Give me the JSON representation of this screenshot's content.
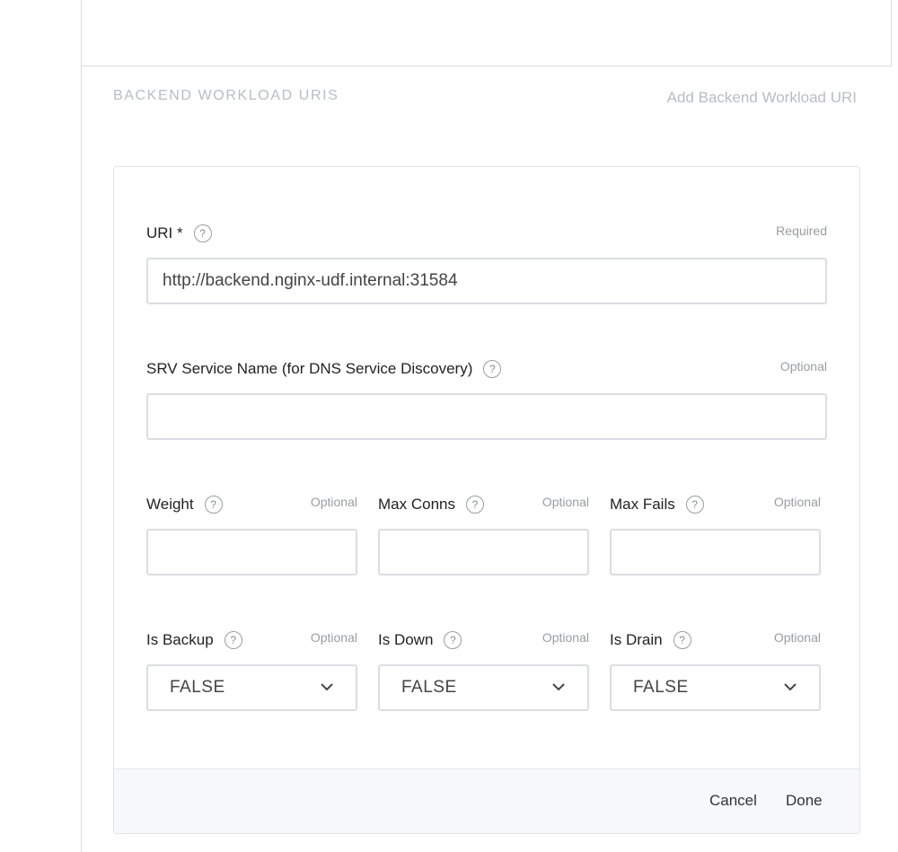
{
  "section": {
    "title": "BACKEND WORKLOAD URIS",
    "add_link": "Add Backend Workload URI"
  },
  "form": {
    "uri": {
      "label": "URI *",
      "hint": "Required",
      "value": "http://backend.nginx-udf.internal:31584"
    },
    "srv": {
      "label": "SRV Service Name (for DNS Service Discovery)",
      "hint": "Optional",
      "value": ""
    },
    "weight": {
      "label": "Weight",
      "hint": "Optional",
      "value": ""
    },
    "max_conns": {
      "label": "Max Conns",
      "hint": "Optional",
      "value": ""
    },
    "max_fails": {
      "label": "Max Fails",
      "hint": "Optional",
      "value": ""
    },
    "is_backup": {
      "label": "Is Backup",
      "hint": "Optional",
      "value": "FALSE"
    },
    "is_down": {
      "label": "Is Down",
      "hint": "Optional",
      "value": "FALSE"
    },
    "is_drain": {
      "label": "Is Drain",
      "hint": "Optional",
      "value": "FALSE"
    },
    "help_glyph": "?"
  },
  "footer": {
    "cancel_label": "Cancel",
    "done_label": "Done"
  },
  "colors": {
    "border": "#dcdde3",
    "muted_text": "#b9bcc6",
    "footer_bg": "#f7f8fa"
  }
}
